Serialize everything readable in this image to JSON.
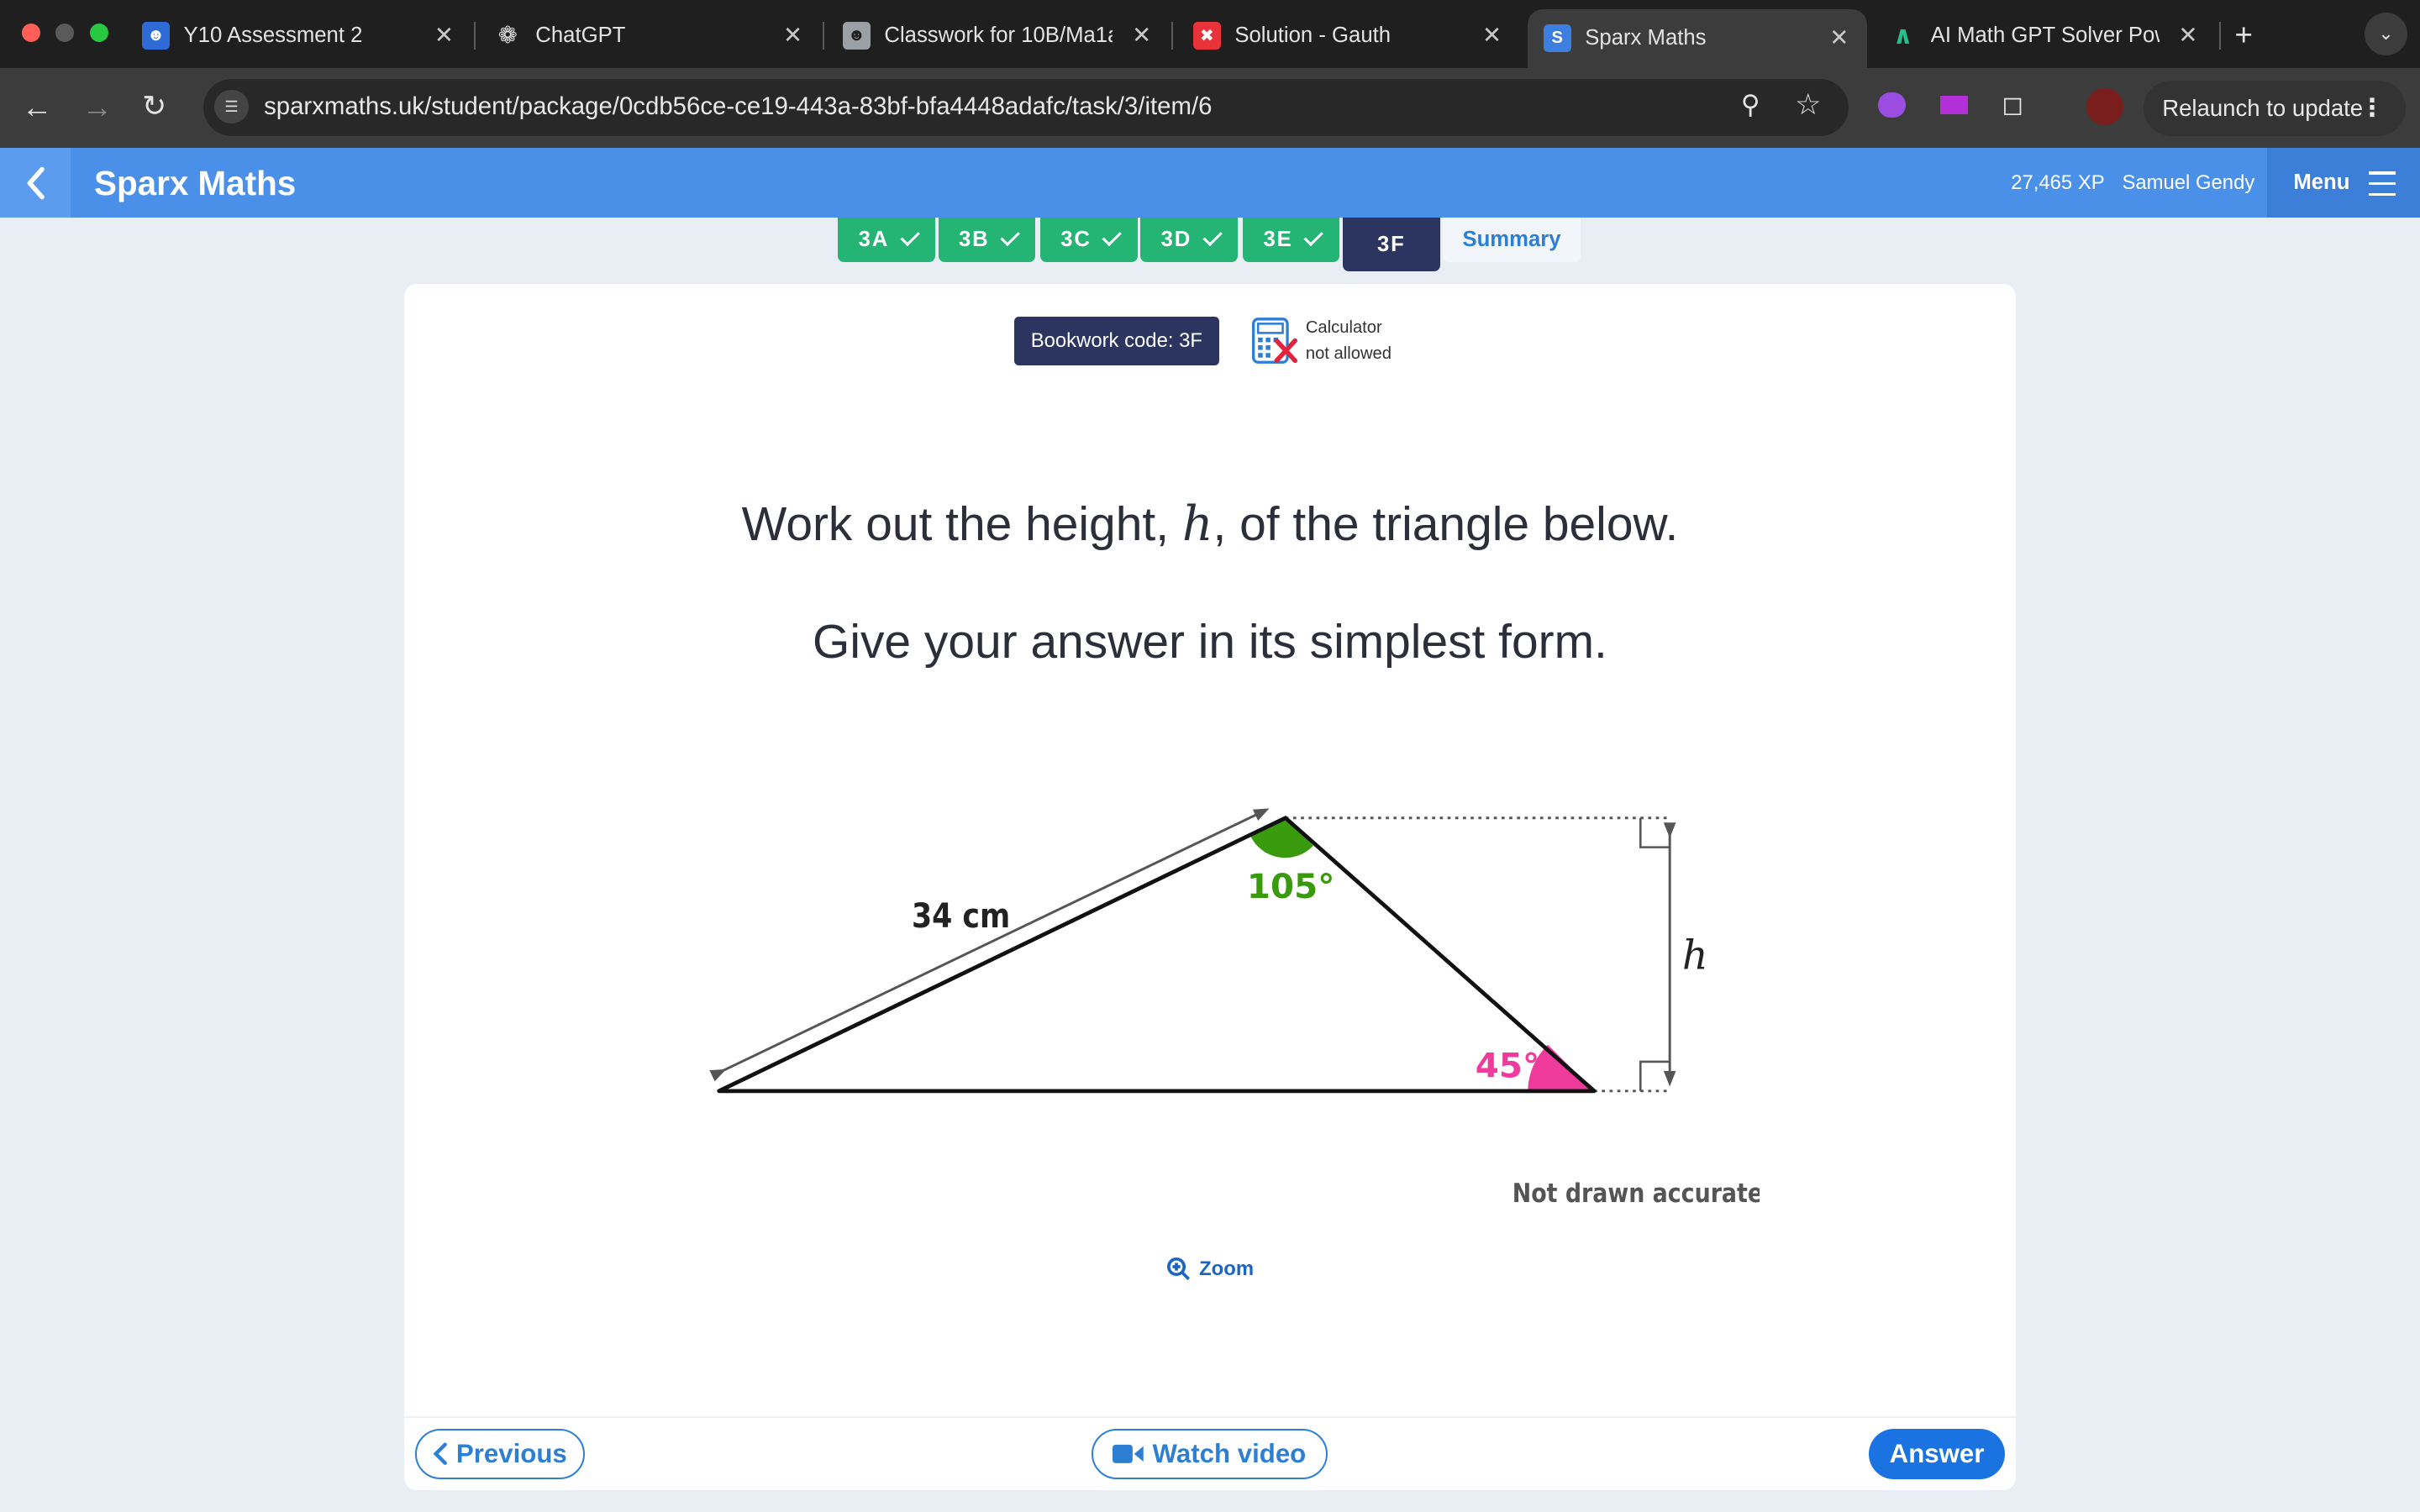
{
  "browser": {
    "tabs": [
      {
        "title": "Y10 Assessment 2",
        "icon": "classroom-icon",
        "color": "#2e6bd6"
      },
      {
        "title": "ChatGPT",
        "icon": "openai-icon",
        "color": "#1f1f1f"
      },
      {
        "title": "Classwork for 10B/Ma1a",
        "icon": "classroom-icon",
        "color": "#9aa0a6"
      },
      {
        "title": "Solution - Gauth",
        "icon": "gauth-icon",
        "color": "#e8333a"
      },
      {
        "title": "Sparx Maths",
        "icon": "sparx-icon",
        "color": "#3d7fe0"
      },
      {
        "title": "AI Math GPT Solver Pow",
        "icon": "math-gpt-icon",
        "color": "#22c08a"
      }
    ],
    "active_tab": 4,
    "url": "sparxmaths.uk/student/package/0cdb56ce-ce19-443a-83bf-bfa4448adafc/task/3/item/6",
    "relaunch_label": "Relaunch to update"
  },
  "header": {
    "brand": "Sparx Maths",
    "xp": "27,465 XP",
    "user": "Samuel Gendy",
    "menu_label": "Menu"
  },
  "task_tabs": [
    {
      "label": "3A",
      "done": true
    },
    {
      "label": "3B",
      "done": true
    },
    {
      "label": "3C",
      "done": true
    },
    {
      "label": "3D",
      "done": true
    },
    {
      "label": "3E",
      "done": true
    },
    {
      "label": "3F",
      "current": true
    },
    {
      "label": "Summary"
    }
  ],
  "question": {
    "bookwork_code": "Bookwork code: 3F",
    "calculator_line1": "Calculator",
    "calculator_line2": "not allowed",
    "line1_before": "Work out the height, ",
    "variable": "h",
    "line1_after": ", of the triangle below.",
    "line2": "Give your answer in its simplest form."
  },
  "diagram": {
    "side_label": "34 cm",
    "top_angle": "105°",
    "bottom_angle": "45°",
    "height_label": "h",
    "note": "Not drawn accurately",
    "colors": {
      "top_angle": "#3a9a0e",
      "bottom_angle": "#ee3b9c"
    }
  },
  "controls": {
    "zoom": "Zoom",
    "previous": "Previous",
    "watch_video": "Watch video",
    "answer": "Answer"
  }
}
